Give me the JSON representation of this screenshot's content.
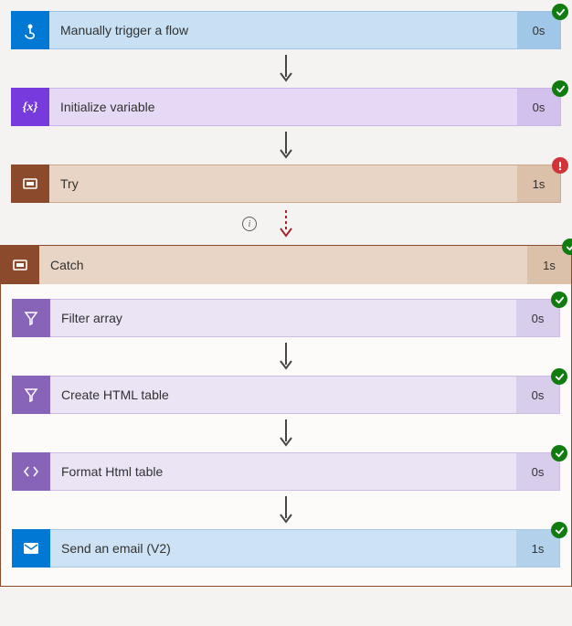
{
  "steps": {
    "manual": {
      "label": "Manually trigger a flow",
      "time": "0s",
      "status": "ok"
    },
    "initvar": {
      "label": "Initialize variable",
      "time": "0s",
      "status": "ok"
    },
    "try": {
      "label": "Try",
      "time": "1s",
      "status": "error"
    },
    "catch": {
      "label": "Catch",
      "time": "1s",
      "status": "ok"
    },
    "filter": {
      "label": "Filter array",
      "time": "0s",
      "status": "ok"
    },
    "html": {
      "label": "Create HTML table",
      "time": "0s",
      "status": "ok"
    },
    "format": {
      "label": "Format Html table",
      "time": "0s",
      "status": "ok"
    },
    "mail": {
      "label": "Send an email (V2)",
      "time": "1s",
      "status": "ok"
    }
  }
}
